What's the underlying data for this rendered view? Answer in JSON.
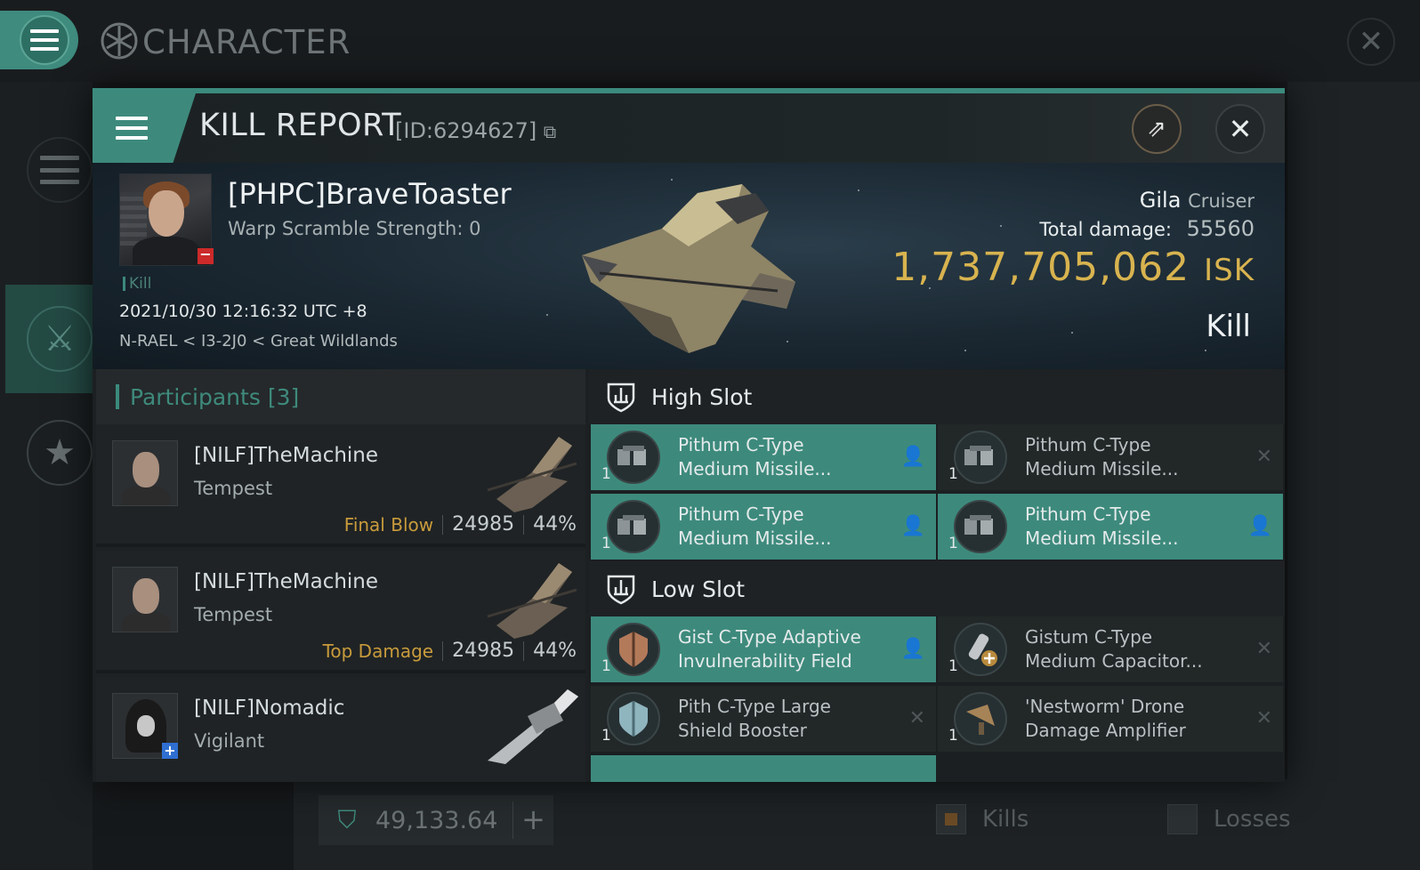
{
  "app": {
    "title": "CHARACTER"
  },
  "bottom_bar": {
    "credit_value": "49,133.64",
    "kills_label": "Kills",
    "losses_label": "Losses"
  },
  "kill_report": {
    "title": "KILL REPORT",
    "id_text": "[ID:6294627]",
    "victim": {
      "name": "[PHPC]BraveToaster",
      "warp_scramble": "Warp Scramble Strength: 0",
      "tag": "Kill",
      "datetime": "2021/10/30 12:16:32 UTC +8",
      "location": "N-RAEL < I3-2J0 < Great Wildlands"
    },
    "ship": {
      "name": "Gila",
      "class": "Cruiser",
      "total_damage_label": "Total damage:",
      "total_damage": "55560",
      "isk_value": "1,737,705,062",
      "isk_unit": "ISK",
      "result": "Kill"
    },
    "participants": {
      "label": "Participants",
      "count": "[3]",
      "items": [
        {
          "name": "[NILF]TheMachine",
          "ship": "Tempest",
          "tag": "Final Blow",
          "damage": "24985",
          "percent": "44%"
        },
        {
          "name": "[NILF]TheMachine",
          "ship": "Tempest",
          "tag": "Top Damage",
          "damage": "24985",
          "percent": "44%"
        },
        {
          "name": "[NILF]Nomadic",
          "ship": "Vigilant",
          "tag": "",
          "damage": "",
          "percent": ""
        }
      ]
    },
    "high_slot": {
      "label": "High Slot",
      "modules": [
        {
          "line1": "Pithum C-Type",
          "line2": "Medium Missile...",
          "qty": "1",
          "status": "dropped"
        },
        {
          "line1": "Pithum C-Type",
          "line2": "Medium Missile...",
          "qty": "1",
          "status": "destroyed"
        },
        {
          "line1": "Pithum C-Type",
          "line2": "Medium Missile...",
          "qty": "1",
          "status": "dropped"
        },
        {
          "line1": "Pithum C-Type",
          "line2": "Medium Missile...",
          "qty": "1",
          "status": "dropped"
        }
      ]
    },
    "low_slot": {
      "label": "Low Slot",
      "modules": [
        {
          "line1": "Gist C-Type Adaptive",
          "line2": "Invulnerability Field",
          "qty": "1",
          "status": "dropped"
        },
        {
          "line1": "Gistum C-Type",
          "line2": "Medium Capacitor...",
          "qty": "1",
          "status": "destroyed"
        },
        {
          "line1": "Pith C-Type Large",
          "line2": "Shield Booster",
          "qty": "1",
          "status": "destroyed"
        },
        {
          "line1": "'Nestworm' Drone",
          "line2": "Damage Amplifier",
          "qty": "1",
          "status": "destroyed"
        }
      ]
    },
    "colors": {
      "accent": "#3d8a7c",
      "isk": "#d8b34f",
      "tag": "#c99b3c",
      "panel": "#1c2022"
    }
  }
}
